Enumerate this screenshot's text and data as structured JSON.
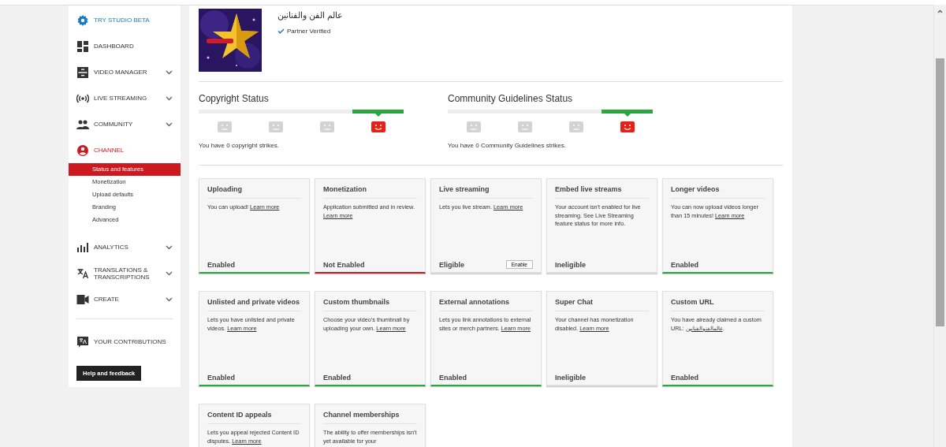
{
  "sidebar": {
    "studio_beta": "TRY STUDIO BETA",
    "items": [
      {
        "label": "DASHBOARD",
        "expandable": false,
        "selected": false
      },
      {
        "label": "VIDEO MANAGER",
        "expandable": true,
        "selected": false
      },
      {
        "label": "LIVE STREAMING",
        "expandable": true,
        "selected": false
      },
      {
        "label": "COMMUNITY",
        "expandable": true,
        "selected": false
      },
      {
        "label": "CHANNEL",
        "expandable": false,
        "selected": true,
        "children": [
          {
            "label": "Status and features",
            "selected": true
          },
          {
            "label": "Monetization",
            "selected": false
          },
          {
            "label": "Upload defaults",
            "selected": false
          },
          {
            "label": "Branding",
            "selected": false
          },
          {
            "label": "Advanced",
            "selected": false
          }
        ]
      },
      {
        "label": "ANALYTICS",
        "expandable": true,
        "selected": false
      },
      {
        "label": "TRANSLATIONS & TRANSCRIPTIONS",
        "expandable": true,
        "selected": false
      },
      {
        "label": "CREATE",
        "expandable": true,
        "selected": false
      }
    ],
    "contributions": "YOUR CONTRIBUTIONS",
    "help_button": "Help and feedback"
  },
  "channel": {
    "name": "عالم الفن والفنانين",
    "badge": "Partner Verified"
  },
  "statuses": [
    {
      "title": "Copyright Status",
      "segments": [
        {
          "selected": false
        },
        {
          "selected": false
        },
        {
          "selected": false
        },
        {
          "selected": true
        }
      ],
      "message": "You have 0 copyright strikes."
    },
    {
      "title": "Community Guidelines Status",
      "segments": [
        {
          "selected": false
        },
        {
          "selected": false
        },
        {
          "selected": false
        },
        {
          "selected": true
        }
      ],
      "message": "You have 0 Community Guidelines strikes."
    }
  ],
  "features": [
    {
      "title": "Uploading",
      "text": "You can upload! ",
      "link": "Learn more",
      "status": "Enabled",
      "kind": "enabled"
    },
    {
      "title": "Monetization",
      "text": "Application submitted and in review. ",
      "link": "Learn more",
      "status": "Not Enabled",
      "kind": "not_enabled"
    },
    {
      "title": "Live streaming",
      "text": "Lets you live stream. ",
      "link": "Learn more",
      "status": "Eligible",
      "kind": "neutral",
      "button": "Enable"
    },
    {
      "title": "Embed live streams",
      "text": "Your account isn't enabled for live streaming. See Live Streaming feature status for more info.",
      "status": "Ineligible",
      "kind": "neutral"
    },
    {
      "title": "Longer videos",
      "text": "You can now upload videos longer than 15 minutes! ",
      "link": "Learn more",
      "status": "Enabled",
      "kind": "enabled"
    },
    {
      "title": "Unlisted and private videos",
      "text": "Lets you have unlisted and private videos. ",
      "link": "Learn more",
      "status": "Enabled",
      "kind": "enabled"
    },
    {
      "title": "Custom thumbnails",
      "text": "Choose your video's thumbnail by uploading your own. ",
      "link": "Learn more",
      "status": "Enabled",
      "kind": "enabled"
    },
    {
      "title": "External annotations",
      "text": "Lets you link annotations to external sites or merch partners. ",
      "link": "Learn more",
      "status": "Enabled",
      "kind": "enabled"
    },
    {
      "title": "Super Chat",
      "text": "Your channel has monetization disabled. ",
      "link": "Learn more",
      "status": "Ineligible",
      "kind": "neutral"
    },
    {
      "title": "Custom URL",
      "text": "You have already claimed a custom URL: ",
      "link": "عالمالفنوالفنانين",
      "after": ".",
      "status": "Enabled",
      "kind": "enabled"
    },
    {
      "title": "Content ID appeals",
      "text": "Lets you appeal rejected Content ID disputes. ",
      "link": "Learn more"
    },
    {
      "title": "Channel memberships",
      "text": "The ability to offer memberships isn't yet available for your"
    }
  ]
}
